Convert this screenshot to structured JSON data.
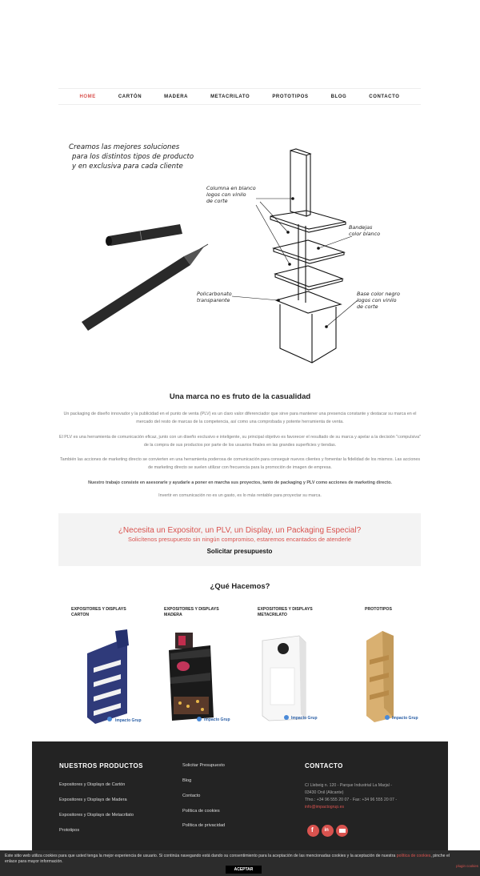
{
  "nav": {
    "items": [
      "HOME",
      "CARTÓN",
      "MADERA",
      "METACRILATO",
      "PROTOTIPOS",
      "BLOG",
      "CONTACTO"
    ],
    "active": "HOME",
    "accent_color": "#d9534f"
  },
  "hero": {
    "title_lines": [
      "Creamos las mejores soluciones",
      "para los distintos tipos de producto",
      "y en exclusiva para cada cliente"
    ],
    "annotations": {
      "columna": [
        "Columna en blanco",
        "logos con vinilo",
        "de corte"
      ],
      "bandejas": [
        "Bandejas",
        "color blanco"
      ],
      "policarbonato": [
        "Policarbonato",
        "transparente"
      ],
      "base": [
        "Base color negro",
        "logos con vinilo",
        "de corte"
      ]
    }
  },
  "about": {
    "title": "Una marca no es fruto de la casualidad",
    "paragraphs": [
      "Un packaging de diseño innovador y la publicidad en el punto de venta (PLV) es un claro valor diferenciador que sirve para mantener una presencia constante y destacar su marca en el mercado del resto de marcas de la competencia, así como una comprobada y potente herramienta de venta.",
      "El PLV es una herramienta de comunicación eficaz, junto con un diseño exclusivo e inteligente, su principal objetivo es favorecer el resultado de su marca y apelar a la decisión \"compulsiva\" de la compra de sus productos por parte de los usuarios finales en las grandes superficies y tiendas.",
      "También las acciones de marketing directo se convierten en una herramienta poderosa de comunicación para conseguir nuevos clientes y fomentar la fidelidad de los mismos. Las acciones de marketing directo se suelen utilizar con frecuencia para la promoción de imagen de empresa.",
      "Nuestro trabajo consiste en asesorarle y ayudarle a poner en marcha sus proyectos, tanto de packaging y PLV como acciones de marketing directo.",
      "Invertir en comunicación no es un gasto, es lo más rentable para proyectar su marca."
    ]
  },
  "cta": {
    "line1": "¿Necesita un Expositor, un PLV, un Display, un Packaging Especial?",
    "line2": "Solicítenos presupuesto sin ningún compromiso, estaremos encantados de atenderle",
    "button": "Solicitar presupuesto"
  },
  "services": {
    "title": "¿Qué Hacemos?",
    "items": [
      {
        "label": "EXPOSITORES Y DISPLAYS CARTON",
        "logo": "Impacto Grup"
      },
      {
        "label": "EXPOSITORES Y DISPLAYS MADERA",
        "logo": "Impacto Grup"
      },
      {
        "label": "EXPOSITORES Y DISPLAYS METACRILATO",
        "logo": "Impacto Grup"
      },
      {
        "label": "PROTOTIPOS",
        "logo": "Impacto Grup"
      }
    ]
  },
  "footer": {
    "products_heading": "NUESTROS PRODUCTOS",
    "products": [
      "Expositores y Displays de Cartón",
      "Expositores y Displays de Madera",
      "Expositores y Displays de Metacrilato",
      "Prototipos"
    ],
    "links": [
      "Solicitar Presupuesto",
      "Blog",
      "Contacto",
      "Política de cookies",
      "Política de privacidad"
    ],
    "contact_heading": "CONTACTO",
    "address_lines": [
      "C/ Llebeig n. 120 - Parque Industrial La Marjal -",
      "03430 Onil (Alicante)",
      "Tfno.: +34 96 555 20 07 - Fax: +34 96 555 20 07 -"
    ],
    "email": "info@impactogrup.es",
    "social_icons": [
      "facebook-icon",
      "linkedin-icon",
      "email-icon"
    ]
  },
  "cookie": {
    "text": "Este sitio web utiliza cookies para que usted tenga la mejor experiencia de usuario. Si continúa navegando está dando su consentimiento para la aceptación de las mencionadas cookies y la aceptación de nuestra",
    "link": "política de cookies",
    "text2": ", pinche el enlace para mayor información.",
    "accept": "ACEPTAR",
    "plugin": "plugin cookies"
  }
}
